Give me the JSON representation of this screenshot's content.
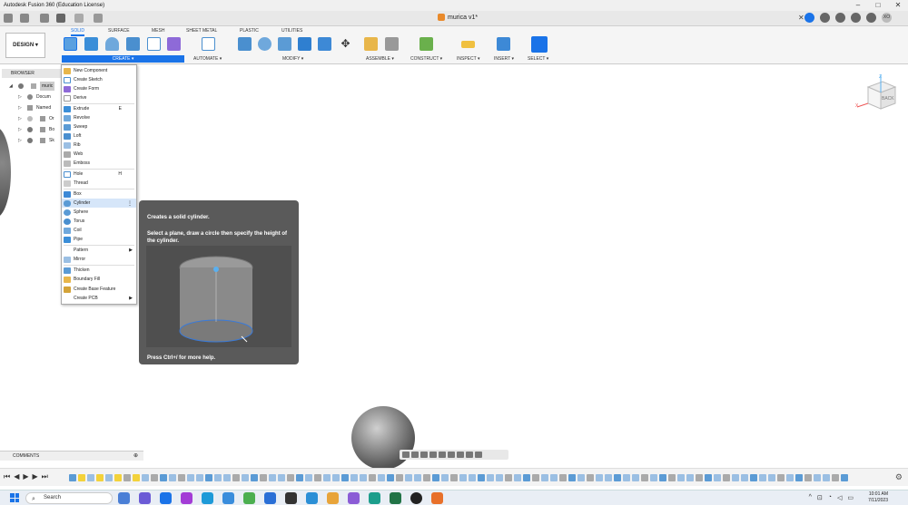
{
  "window": {
    "title": "Autodesk Fusion 360 (Education License)"
  },
  "document": {
    "tab_name": "murica v1*"
  },
  "user": {
    "initials": "XO"
  },
  "ribbon": {
    "design_label": "DESIGN ▾",
    "tabs": [
      "SOLID",
      "SURFACE",
      "MESH",
      "SHEET METAL",
      "PLASTIC",
      "UTILITIES"
    ],
    "groups": [
      "CREATE ▾",
      "AUTOMATE ▾",
      "MODIFY ▾",
      "ASSEMBLE ▾",
      "CONSTRUCT ▾",
      "INSPECT ▾",
      "INSERT ▾",
      "SELECT ▾"
    ]
  },
  "browser": {
    "header": "BROWSER",
    "root": "muric",
    "rows": [
      "Docum",
      "Named",
      "Or",
      "Bo",
      "Sk"
    ]
  },
  "create_menu": {
    "items": [
      {
        "label": "New Component"
      },
      {
        "label": "Create Sketch"
      },
      {
        "label": "Create Form"
      },
      {
        "label": "Derive"
      },
      {
        "label": "Extrude",
        "shortcut": "E"
      },
      {
        "label": "Revolve"
      },
      {
        "label": "Sweep"
      },
      {
        "label": "Loft"
      },
      {
        "label": "Rib"
      },
      {
        "label": "Web"
      },
      {
        "label": "Emboss"
      },
      {
        "label": "Hole",
        "shortcut": "H"
      },
      {
        "label": "Thread"
      },
      {
        "label": "Box"
      },
      {
        "label": "Cylinder"
      },
      {
        "label": "Sphere"
      },
      {
        "label": "Torus"
      },
      {
        "label": "Coil"
      },
      {
        "label": "Pipe"
      },
      {
        "label": "Pattern"
      },
      {
        "label": "Mirror"
      },
      {
        "label": "Thicken"
      },
      {
        "label": "Boundary Fill"
      },
      {
        "label": "Create Base Feature"
      },
      {
        "label": "Create PCB"
      }
    ]
  },
  "tooltip": {
    "title": "Creates a solid cylinder.",
    "body": "Select a plane, draw a circle then specify the height of the cylinder.",
    "footer": "Press Ctrl+/ for more help."
  },
  "viewcube": {
    "face": "BACK",
    "axis_x": "X",
    "axis_z": "Z"
  },
  "comments": {
    "label": "COMMENTS"
  },
  "taskbar": {
    "search_label": "Search",
    "time": "10:01 AM",
    "date": "7/11/2023"
  },
  "colors": {
    "accent": "#1a73e8",
    "tooltip_bg": "#5a5a5a",
    "highlight": "#d6e6f9"
  }
}
